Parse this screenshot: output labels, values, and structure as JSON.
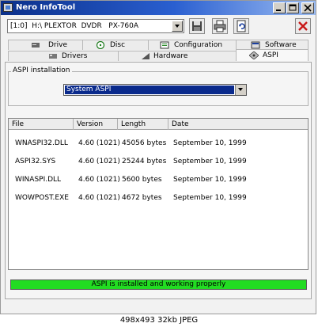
{
  "window": {
    "title": "Nero InfoTool",
    "controls": [
      "minimize-icon",
      "maximize-icon",
      "close-icon"
    ]
  },
  "toolbar": {
    "drive": "[1:0]  H:\\ PLEXTOR  DVDR   PX-760A",
    "icons": [
      "save-icon",
      "print-icon",
      "refresh-icon",
      "close-red-icon"
    ]
  },
  "tabs": {
    "row1": [
      {
        "label": "Drive",
        "icon": "drive-icon"
      },
      {
        "label": "Disc",
        "icon": "disc-icon"
      },
      {
        "label": "Configuration",
        "icon": "configuration-icon"
      },
      {
        "label": "Software",
        "icon": "software-icon"
      }
    ],
    "row2": [
      {
        "label": "Drivers",
        "icon": "drivers-icon"
      },
      {
        "label": "Hardware",
        "icon": "hardware-icon"
      },
      {
        "label": "ASPI",
        "icon": "aspi-icon",
        "active": true
      }
    ]
  },
  "aspi": {
    "group_label": "ASPI installation",
    "selected": "System ASPI"
  },
  "files": {
    "columns": [
      "File",
      "Version",
      "Length",
      "Date"
    ],
    "rows": [
      {
        "file": "WNASPI32.DLL",
        "version": "4.60 (1021)",
        "length": "45056 bytes",
        "date": "September 10, 1999"
      },
      {
        "file": "ASPI32.SYS",
        "version": "4.60 (1021)",
        "length": "25244 bytes",
        "date": "September 10, 1999"
      },
      {
        "file": "WINASPI.DLL",
        "version": "4.60 (1021)",
        "length": "5600 bytes",
        "date": "September 10, 1999"
      },
      {
        "file": "WOWPOST.EXE",
        "version": "4.60 (1021)",
        "length": "4672 bytes",
        "date": "September 10, 1999"
      }
    ]
  },
  "status": {
    "text": "ASPI is installed and working properly",
    "color": "#22dc22"
  },
  "caption": "498x493 32kb JPEG",
  "colors": {
    "titlebar": "#0a2f8a",
    "selection": "#0a2a8c",
    "status_ok": "#22dc22"
  }
}
